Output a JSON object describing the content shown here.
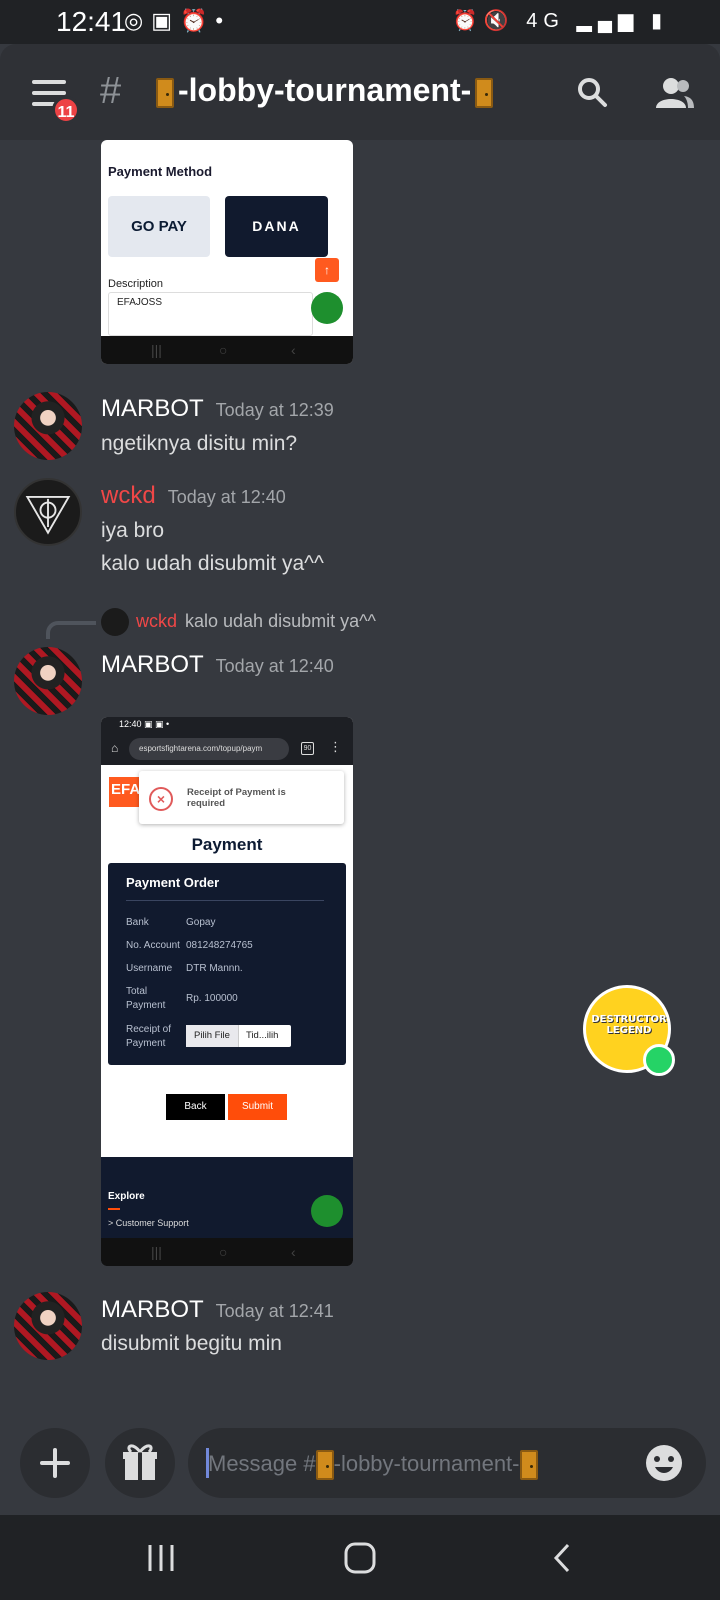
{
  "status_bar": {
    "time": "12:41",
    "network": "4G"
  },
  "header": {
    "notification_count": "11",
    "channel_name": "-lobby-tournament-"
  },
  "messages": [
    {
      "author": "MARBOT",
      "time": "Today at 12:39",
      "text": "ngetiknya disitu min?"
    },
    {
      "author": "wckd",
      "time": "Today at 12:40",
      "lines": [
        "iya bro",
        "kalo udah disubmit ya^^"
      ],
      "name_color": "#f04747"
    },
    {
      "reply_to": {
        "author": "wckd",
        "text": "kalo udah disubmit ya^^"
      },
      "author": "MARBOT",
      "time": "Today at 12:40"
    },
    {
      "author": "MARBOT",
      "time": "Today at 12:41",
      "text": "disubmit begitu min"
    }
  ],
  "screenshot_1": {
    "section_title": "Payment Method",
    "methods": [
      "GO PAY",
      "DANA"
    ],
    "description_label": "Description",
    "description_value": "EFAJOSS"
  },
  "screenshot_2": {
    "status_time": "12:40",
    "url": "esportsfightarena.com/topup/paym",
    "tab_count": "90",
    "logo": "EFA",
    "error": "Receipt of Payment is required",
    "page_title": "Payment",
    "card_title": "Payment Order",
    "rows": [
      {
        "label": "Bank",
        "value": "Gopay"
      },
      {
        "label": "No. Account",
        "value": "081248274765"
      },
      {
        "label": "Username",
        "value": "DTR Mannn."
      },
      {
        "label": "Total Payment",
        "value": "Rp. 100000"
      }
    ],
    "receipt_label": "Receipt of Payment",
    "file_button": "Pilih File",
    "file_status": "Tid...ilih",
    "back_label": "Back",
    "submit_label": "Submit",
    "footer_title": "Explore",
    "footer_link": "> Customer Support"
  },
  "floating_avatar": {
    "text": "DESTRUCTOR LEGEND"
  },
  "composer": {
    "placeholder": "Message #"
  }
}
